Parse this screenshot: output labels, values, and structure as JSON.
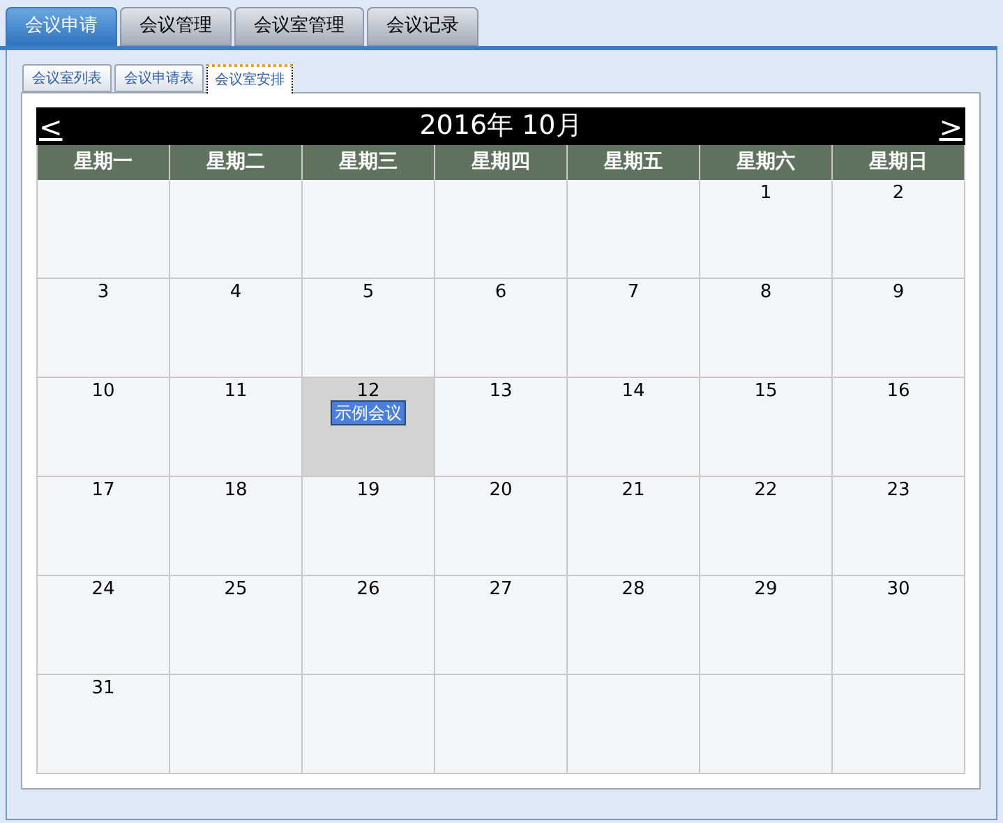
{
  "main_tabs": [
    {
      "label": "会议申请",
      "selected": true
    },
    {
      "label": "会议管理",
      "selected": false
    },
    {
      "label": "会议室管理",
      "selected": false
    },
    {
      "label": "会议记录",
      "selected": false
    }
  ],
  "sub_tabs": [
    {
      "label": "会议室列表",
      "selected": false
    },
    {
      "label": "会议申请表",
      "selected": false
    },
    {
      "label": "会议室安排",
      "selected": true
    }
  ],
  "calendar": {
    "prev": "<",
    "title": "2016年 10月",
    "next": ">",
    "weekdays": [
      "星期一",
      "星期二",
      "星期三",
      "星期四",
      "星期五",
      "星期六",
      "星期日"
    ],
    "weeks": [
      [
        {
          "kind": "blank"
        },
        {
          "kind": "blank"
        },
        {
          "kind": "blank"
        },
        {
          "kind": "blank"
        },
        {
          "kind": "blank"
        },
        {
          "kind": "day",
          "day": "1",
          "selected": false
        },
        {
          "kind": "day",
          "day": "2",
          "selected": false
        }
      ],
      [
        {
          "kind": "day",
          "day": "3",
          "selected": false
        },
        {
          "kind": "day",
          "day": "4",
          "selected": false
        },
        {
          "kind": "day",
          "day": "5",
          "selected": false
        },
        {
          "kind": "day",
          "day": "6",
          "selected": false
        },
        {
          "kind": "day",
          "day": "7",
          "selected": false
        },
        {
          "kind": "day",
          "day": "8",
          "selected": false
        },
        {
          "kind": "day",
          "day": "9",
          "selected": false
        }
      ],
      [
        {
          "kind": "day",
          "day": "10",
          "selected": false
        },
        {
          "kind": "day",
          "day": "11",
          "selected": false
        },
        {
          "kind": "day",
          "day": "12",
          "selected": true,
          "events": [
            "示例会议"
          ]
        },
        {
          "kind": "day",
          "day": "13",
          "selected": false
        },
        {
          "kind": "day",
          "day": "14",
          "selected": false
        },
        {
          "kind": "day",
          "day": "15",
          "selected": false
        },
        {
          "kind": "day",
          "day": "16",
          "selected": false
        }
      ],
      [
        {
          "kind": "day",
          "day": "17",
          "selected": false
        },
        {
          "kind": "day",
          "day": "18",
          "selected": false
        },
        {
          "kind": "day",
          "day": "19",
          "selected": false
        },
        {
          "kind": "day",
          "day": "20",
          "selected": false
        },
        {
          "kind": "day",
          "day": "21",
          "selected": false
        },
        {
          "kind": "day",
          "day": "22",
          "selected": false
        },
        {
          "kind": "day",
          "day": "23",
          "selected": false
        }
      ],
      [
        {
          "kind": "day",
          "day": "24",
          "selected": false
        },
        {
          "kind": "day",
          "day": "25",
          "selected": false
        },
        {
          "kind": "day",
          "day": "26",
          "selected": false
        },
        {
          "kind": "day",
          "day": "27",
          "selected": false
        },
        {
          "kind": "day",
          "day": "28",
          "selected": false
        },
        {
          "kind": "day",
          "day": "29",
          "selected": false
        },
        {
          "kind": "day",
          "day": "30",
          "selected": false
        }
      ],
      [
        {
          "kind": "day",
          "day": "31",
          "selected": false
        },
        {
          "kind": "blank"
        },
        {
          "kind": "blank"
        },
        {
          "kind": "blank"
        },
        {
          "kind": "blank"
        },
        {
          "kind": "blank"
        },
        {
          "kind": "blank"
        }
      ]
    ]
  }
}
